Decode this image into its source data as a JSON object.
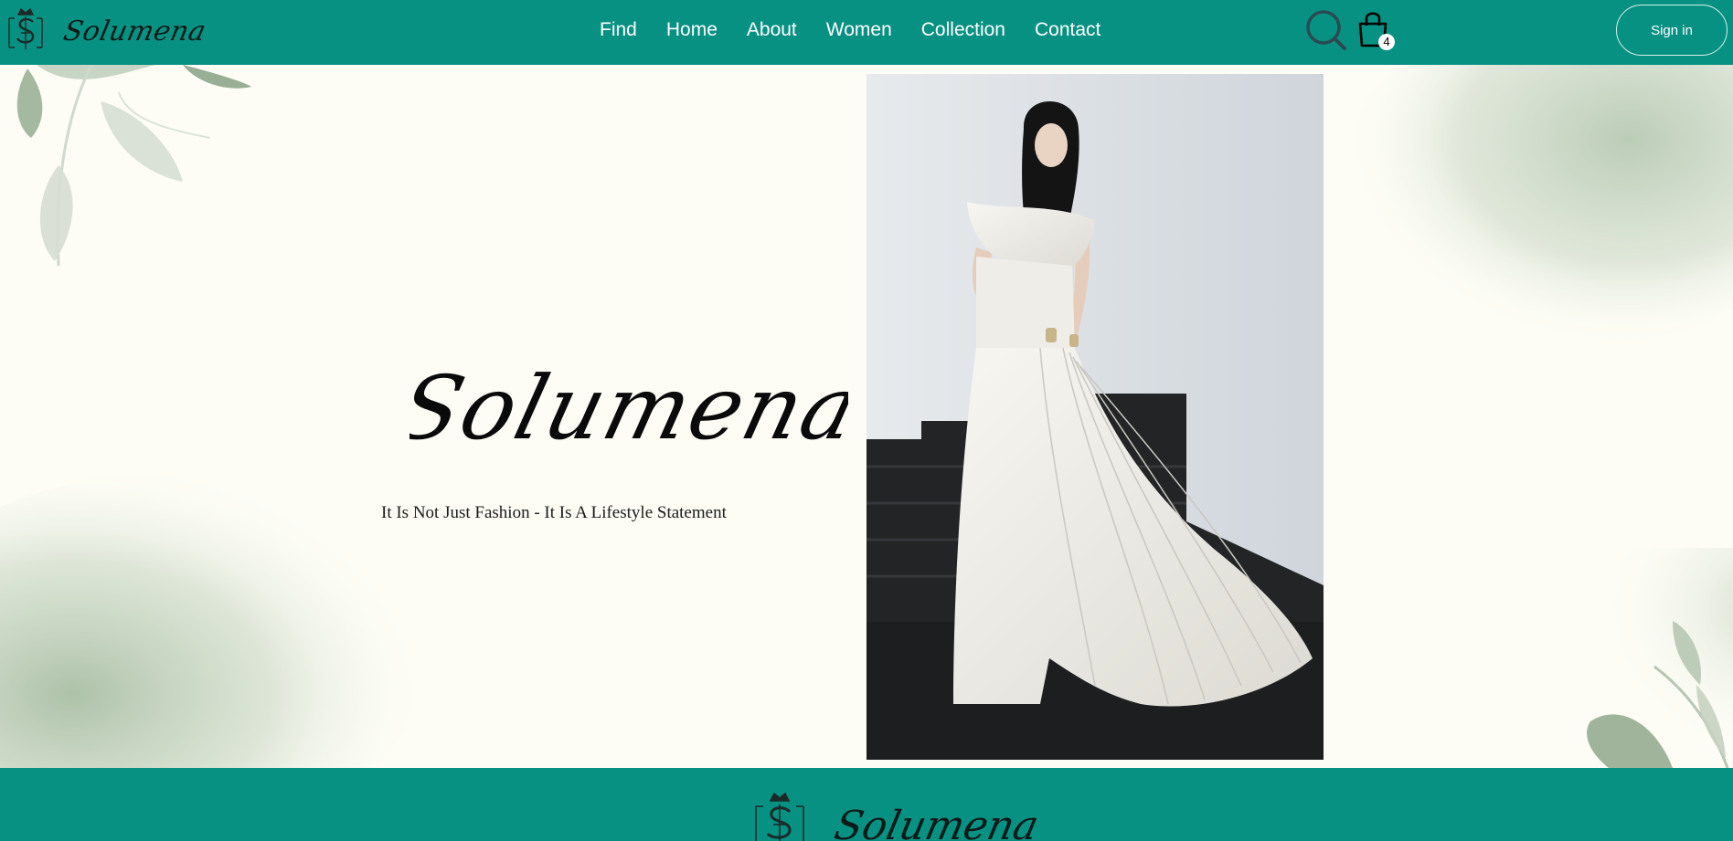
{
  "brand": {
    "name": "Solumena"
  },
  "nav": {
    "items": [
      {
        "label": "Find"
      },
      {
        "label": "Home"
      },
      {
        "label": "About"
      },
      {
        "label": "Women"
      },
      {
        "label": "Collection"
      },
      {
        "label": "Contact"
      }
    ]
  },
  "actions": {
    "cart_count": "4",
    "signin_label": "Sign in",
    "search_icon": "search-icon",
    "cart_icon": "shopping-bag-icon"
  },
  "hero": {
    "title": "Solumena",
    "tagline": "It Is Not Just Fashion - It Is A Lifestyle Statement"
  },
  "footer": {
    "brand_name": "Solumena"
  },
  "colors": {
    "primary": "#079182",
    "background": "#fdfdf6",
    "text": "#1a1a1a",
    "accent_green": "#9db59a"
  }
}
